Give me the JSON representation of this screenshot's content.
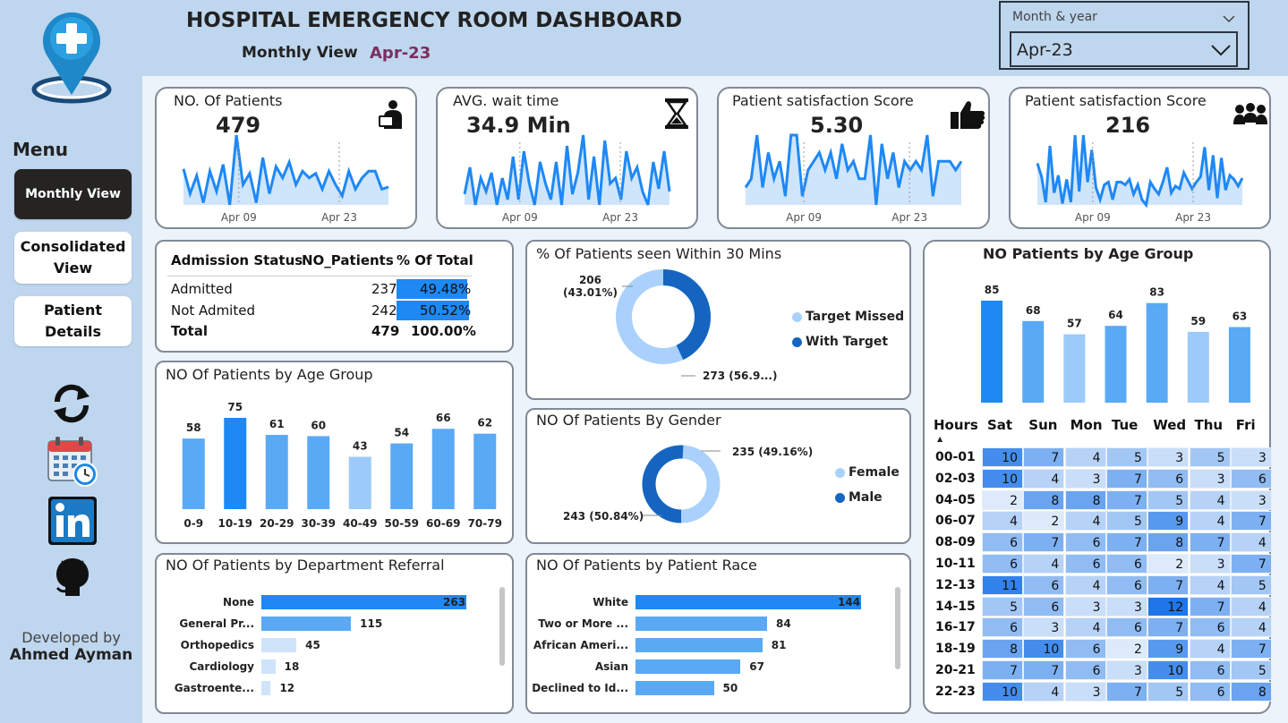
{
  "header": {
    "title": "HOSPITAL EMERGENCY ROOM DASHBOARD",
    "subtitle": "Monthly View",
    "period": "Apr-23"
  },
  "filter": {
    "label": "Month & year",
    "value": "Apr-23"
  },
  "menu": {
    "title": "Menu",
    "items": [
      {
        "label": "Monthly View",
        "active": true
      },
      {
        "label": "Consolidated View",
        "active": false
      },
      {
        "label": "Patient Details",
        "active": false
      }
    ]
  },
  "developer": {
    "line1": "Developed by",
    "line2": "Ahmed Ayman"
  },
  "kpis": [
    {
      "title": "NO. Of Patients",
      "value": "479",
      "icon": "patient-icon",
      "ticks": [
        "Apr 09",
        "Apr 23"
      ],
      "series": [
        37,
        26,
        34,
        22,
        36,
        27,
        39,
        21,
        52,
        30,
        35,
        22,
        42,
        26,
        38,
        33,
        40,
        30,
        36,
        33,
        35,
        28,
        36,
        30,
        25,
        36,
        28,
        33,
        36,
        36,
        28,
        29
      ]
    },
    {
      "title": "AVG. wait time",
      "value": "34.9 Min",
      "icon": "hourglass-icon",
      "ticks": [
        "Apr 09",
        "Apr 23"
      ],
      "series": [
        24,
        34,
        20,
        30,
        25,
        32,
        20,
        30,
        22,
        38,
        22,
        40,
        28,
        20,
        36,
        28,
        22,
        36,
        20,
        42,
        24,
        32,
        46,
        22,
        38,
        20,
        44,
        28,
        30,
        22,
        40,
        30,
        34,
        25,
        20,
        36,
        26,
        40,
        25
      ]
    },
    {
      "title": "Patient satisfaction Score",
      "value": "5.30",
      "icon": "thumbs-up-icon",
      "ticks": [
        "Apr 09",
        "Apr 23"
      ],
      "series": [
        3,
        4,
        9,
        3,
        7,
        4,
        6,
        2,
        9,
        9,
        2,
        5,
        6,
        7,
        5,
        7,
        4,
        8,
        5,
        6,
        4,
        4,
        9,
        1,
        8,
        4,
        7,
        3,
        6,
        5,
        6,
        5,
        9,
        2,
        6,
        6,
        6,
        5,
        6
      ]
    },
    {
      "title": "Patient satisfaction Score",
      "value": "216",
      "icon": "group-icon",
      "ticks": [
        "Apr 09",
        "Apr 23"
      ],
      "series": [
        36,
        26,
        7,
        49,
        14,
        27,
        6,
        24,
        7,
        57,
        15,
        57,
        22,
        46,
        18,
        9,
        20,
        22,
        9,
        22,
        22,
        20,
        24,
        13,
        20,
        9,
        5,
        22,
        17,
        13,
        22,
        33,
        14,
        19,
        17,
        29,
        23,
        17,
        22,
        26,
        48,
        16,
        42,
        10,
        40,
        16,
        27,
        24,
        19,
        25
      ]
    }
  ],
  "admission_table": {
    "headers": [
      "Admission Status",
      "NO_Patients",
      "% Of Total"
    ],
    "rows": [
      {
        "status": "Admitted",
        "count": "237",
        "pct": "49.48%",
        "fraction": 0.4948
      },
      {
        "status": "Not Admited",
        "count": "242",
        "pct": "50.52%",
        "fraction": 0.5052
      }
    ],
    "total": {
      "status": "Total",
      "count": "479",
      "pct": "100.00%"
    }
  },
  "donut_30min": {
    "title": "% Of Patients seen Within 30 Mins",
    "label_top_count": "206",
    "label_top_pct": "(43.01%)",
    "label_bottom": "273 (56.9...)",
    "legend": [
      "Target Missed",
      "With Target"
    ],
    "colors": [
      "#a9d1fb",
      "#1565c0"
    ],
    "chart_data": {
      "type": "pie",
      "categories": [
        "With Target",
        "Target Missed"
      ],
      "values": [
        206,
        273
      ]
    }
  },
  "donut_gender": {
    "title": "NO Of Patients By Gender",
    "label_top": "235 (49.16%)",
    "label_bottom": "243 (50.84%)",
    "legend": [
      "Female",
      "Male"
    ],
    "colors": [
      "#a9d1fb",
      "#1565c0"
    ],
    "chart_data": {
      "type": "pie",
      "categories": [
        "Female",
        "Male"
      ],
      "values": [
        235,
        243
      ]
    }
  },
  "age_group_chart": {
    "title": "NO Of Patients by Age Group",
    "chart_data": {
      "type": "bar",
      "categories": [
        "0-9",
        "10-19",
        "20-29",
        "30-39",
        "40-49",
        "50-59",
        "60-69",
        "70-79"
      ],
      "values": [
        58,
        75,
        61,
        60,
        43,
        54,
        66,
        62
      ]
    }
  },
  "dept_chart": {
    "title": "NO Of Patients by Department Referral",
    "chart_data": {
      "type": "bar",
      "categories": [
        "None",
        "General Pr...",
        "Orthopedics",
        "Cardiology",
        "Gastroente..."
      ],
      "values": [
        263,
        115,
        45,
        18,
        12
      ]
    }
  },
  "race_chart": {
    "title": "NO Of Patients by Patient Race",
    "chart_data": {
      "type": "bar",
      "categories": [
        "White",
        "Two or More ...",
        "African Ameri...",
        "Asian",
        "Declined to Id..."
      ],
      "values": [
        144,
        84,
        81,
        67,
        50
      ]
    }
  },
  "weekday_chart": {
    "title": "NO Patients by Age Group",
    "chart_data": {
      "type": "bar",
      "categories": [
        "Sat",
        "Sun",
        "Mon",
        "Tue",
        "Wed",
        "Thu",
        "Fri"
      ],
      "values": [
        85,
        68,
        57,
        64,
        83,
        59,
        63
      ]
    }
  },
  "heatmap": {
    "hours_header": "Hours",
    "days": [
      "Sat",
      "Sun",
      "Mon",
      "Tue",
      "Wed",
      "Thu",
      "Fri"
    ],
    "rows": [
      {
        "hour": "00-01",
        "values": [
          10,
          7,
          4,
          5,
          3,
          5,
          3
        ]
      },
      {
        "hour": "02-03",
        "values": [
          10,
          4,
          3,
          7,
          6,
          3,
          6
        ]
      },
      {
        "hour": "04-05",
        "values": [
          2,
          8,
          8,
          7,
          5,
          4,
          3
        ]
      },
      {
        "hour": "06-07",
        "values": [
          4,
          2,
          4,
          5,
          9,
          4,
          7
        ]
      },
      {
        "hour": "08-09",
        "values": [
          6,
          7,
          6,
          7,
          8,
          7,
          4
        ]
      },
      {
        "hour": "10-11",
        "values": [
          6,
          4,
          6,
          6,
          2,
          3,
          7
        ]
      },
      {
        "hour": "12-13",
        "values": [
          11,
          6,
          4,
          6,
          7,
          4,
          5
        ]
      },
      {
        "hour": "14-15",
        "values": [
          5,
          6,
          3,
          3,
          12,
          7,
          4
        ]
      },
      {
        "hour": "16-17",
        "values": [
          6,
          3,
          4,
          6,
          7,
          6,
          4
        ]
      },
      {
        "hour": "18-19",
        "values": [
          8,
          10,
          6,
          2,
          9,
          4,
          7
        ]
      },
      {
        "hour": "20-21",
        "values": [
          7,
          7,
          6,
          3,
          10,
          6,
          5
        ]
      },
      {
        "hour": "22-23",
        "values": [
          10,
          4,
          3,
          7,
          5,
          6,
          8
        ]
      }
    ]
  },
  "colors": {
    "bar_dark": "#1e88f5",
    "bar_mid": "#5aa9f5",
    "bar_light": "#9ccbf9",
    "line": "#1e88f5",
    "area": "#cfe5fb"
  }
}
